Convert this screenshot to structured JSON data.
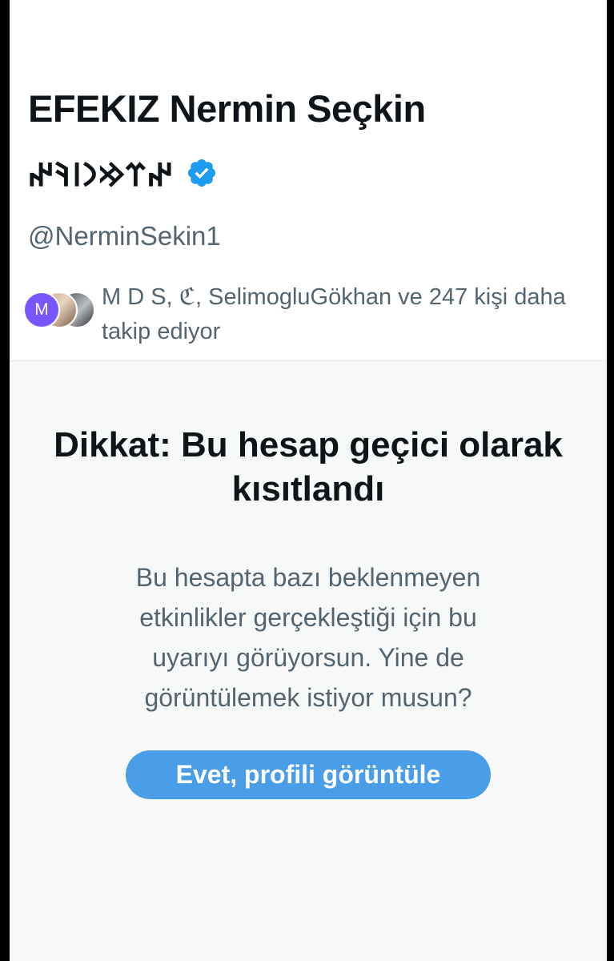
{
  "profile": {
    "display_name": "EFEKIZ Nermin Seçkin",
    "runic_name": "𐰤𐰼𐰢𐰣𐰾𐰚𐰤",
    "verified": true,
    "verified_icon": "verified-badge-icon",
    "accent_color": "#1d9bf0",
    "handle": "@NerminSekin1"
  },
  "followers": {
    "avatar_initial": "M",
    "text": "M D S, ℭ, SelimogluGökhan ve 247 kişi daha takip ediyor"
  },
  "warning": {
    "title": "Dikkat: Bu hesap geçici olarak kısıtlandı",
    "body": "Bu hesapta bazı beklenmeyen etkinlikler gerçekleştiği için bu uyarıyı görüyorsun. Yine de görüntülemek istiyor musun?",
    "button_label": "Evet, profili görüntüle",
    "button_color": "#4a9ee8"
  }
}
